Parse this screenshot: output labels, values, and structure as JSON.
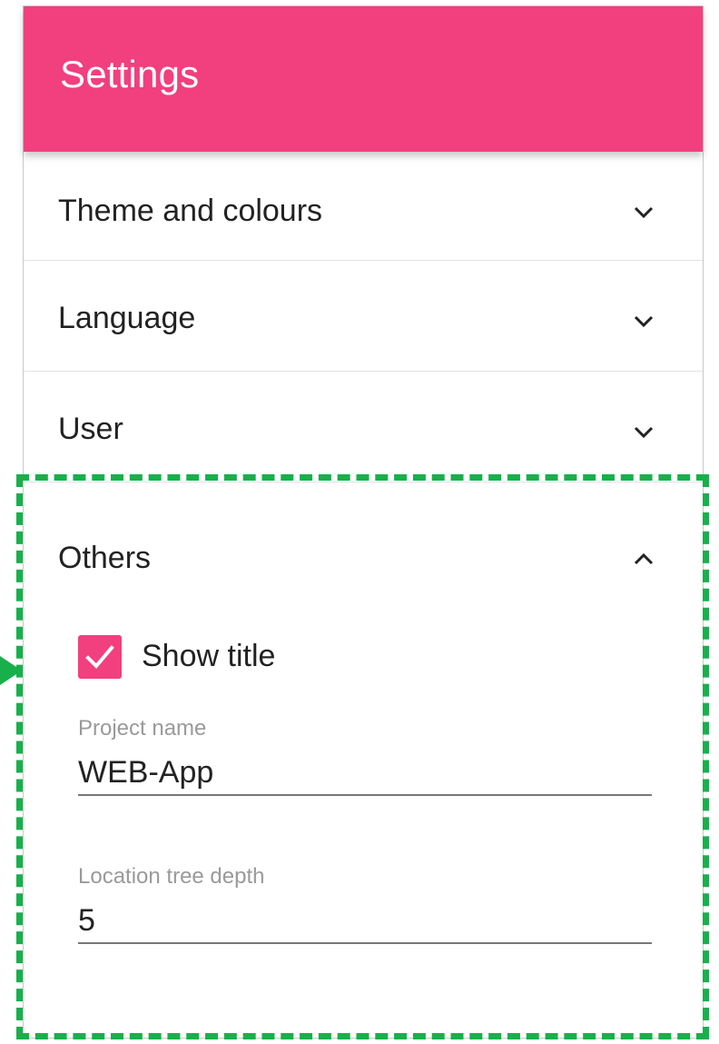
{
  "header": {
    "title": "Settings"
  },
  "accordion": {
    "items": [
      {
        "label": "Theme and colours",
        "expanded": false
      },
      {
        "label": "Language",
        "expanded": false
      },
      {
        "label": "User",
        "expanded": false
      },
      {
        "label": "Others",
        "expanded": true
      }
    ]
  },
  "others": {
    "show_title": {
      "label": "Show title",
      "checked": true
    },
    "project_name": {
      "label": "Project name",
      "value": "WEB-App"
    },
    "location_tree_depth": {
      "label": "Location tree depth",
      "value": "5"
    }
  },
  "icons": {
    "collapsed": "chevron-down-icon",
    "expanded": "chevron-up-icon",
    "checked": "checkmark-icon"
  },
  "colors": {
    "accent": "#f23f7e",
    "highlight": "#18b04b",
    "text": "#222222",
    "label": "#9a9a9a"
  }
}
